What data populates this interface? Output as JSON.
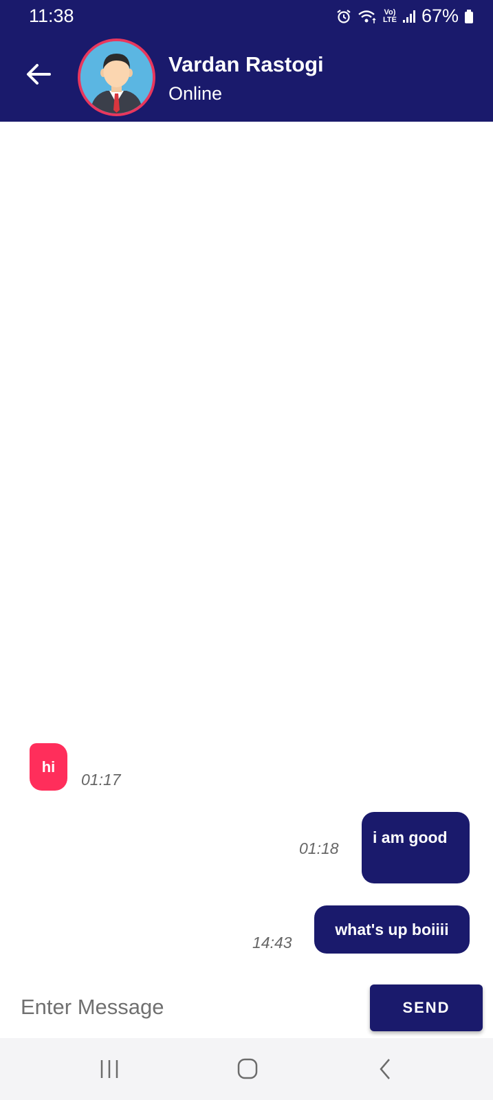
{
  "status_bar": {
    "time": "11:38",
    "network_label": "Vo)\nLTE",
    "battery_percent": "67%",
    "icons": [
      "alarm-icon",
      "wifi-icon",
      "volte-icon",
      "signal-icon",
      "battery-icon"
    ]
  },
  "header": {
    "contact_name": "Vardan Rastogi",
    "contact_status": "Online",
    "back_icon": "arrow-left-icon",
    "avatar_icon": "businessman-avatar"
  },
  "messages": [
    {
      "direction": "incoming",
      "text": "hi",
      "time": "01:17"
    },
    {
      "direction": "outgoing",
      "text": "i am good",
      "time": "01:18"
    },
    {
      "direction": "outgoing",
      "text": "what's up boiiii",
      "time": "14:43"
    }
  ],
  "composer": {
    "placeholder": "Enter Message",
    "value": "",
    "send_label": "SEND"
  },
  "nav_bar": {
    "icons": [
      "recent-apps-icon",
      "home-icon",
      "back-icon"
    ]
  },
  "colors": {
    "primary": "#1a1a6c",
    "incoming_bubble": "#ff2e5b",
    "avatar_ring": "#e8375d",
    "avatar_bg": "#5bb6e2"
  }
}
